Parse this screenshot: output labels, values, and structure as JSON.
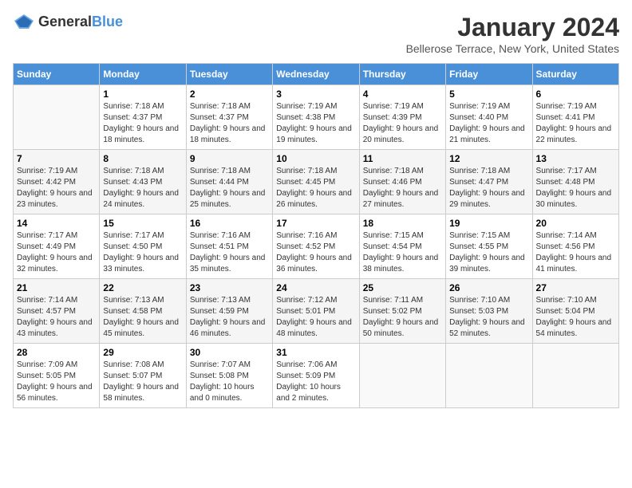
{
  "app": {
    "name_general": "General",
    "name_blue": "Blue"
  },
  "header": {
    "month": "January 2024",
    "location": "Bellerose Terrace, New York, United States"
  },
  "weekdays": [
    "Sunday",
    "Monday",
    "Tuesday",
    "Wednesday",
    "Thursday",
    "Friday",
    "Saturday"
  ],
  "weeks": [
    [
      {
        "day": "",
        "sunrise": "",
        "sunset": "",
        "daylight": ""
      },
      {
        "day": "1",
        "sunrise": "Sunrise: 7:18 AM",
        "sunset": "Sunset: 4:37 PM",
        "daylight": "Daylight: 9 hours and 18 minutes."
      },
      {
        "day": "2",
        "sunrise": "Sunrise: 7:18 AM",
        "sunset": "Sunset: 4:37 PM",
        "daylight": "Daylight: 9 hours and 18 minutes."
      },
      {
        "day": "3",
        "sunrise": "Sunrise: 7:19 AM",
        "sunset": "Sunset: 4:38 PM",
        "daylight": "Daylight: 9 hours and 19 minutes."
      },
      {
        "day": "4",
        "sunrise": "Sunrise: 7:19 AM",
        "sunset": "Sunset: 4:39 PM",
        "daylight": "Daylight: 9 hours and 20 minutes."
      },
      {
        "day": "5",
        "sunrise": "Sunrise: 7:19 AM",
        "sunset": "Sunset: 4:40 PM",
        "daylight": "Daylight: 9 hours and 21 minutes."
      },
      {
        "day": "6",
        "sunrise": "Sunrise: 7:19 AM",
        "sunset": "Sunset: 4:41 PM",
        "daylight": "Daylight: 9 hours and 22 minutes."
      }
    ],
    [
      {
        "day": "7",
        "sunrise": "Sunrise: 7:19 AM",
        "sunset": "Sunset: 4:42 PM",
        "daylight": "Daylight: 9 hours and 23 minutes."
      },
      {
        "day": "8",
        "sunrise": "Sunrise: 7:18 AM",
        "sunset": "Sunset: 4:43 PM",
        "daylight": "Daylight: 9 hours and 24 minutes."
      },
      {
        "day": "9",
        "sunrise": "Sunrise: 7:18 AM",
        "sunset": "Sunset: 4:44 PM",
        "daylight": "Daylight: 9 hours and 25 minutes."
      },
      {
        "day": "10",
        "sunrise": "Sunrise: 7:18 AM",
        "sunset": "Sunset: 4:45 PM",
        "daylight": "Daylight: 9 hours and 26 minutes."
      },
      {
        "day": "11",
        "sunrise": "Sunrise: 7:18 AM",
        "sunset": "Sunset: 4:46 PM",
        "daylight": "Daylight: 9 hours and 27 minutes."
      },
      {
        "day": "12",
        "sunrise": "Sunrise: 7:18 AM",
        "sunset": "Sunset: 4:47 PM",
        "daylight": "Daylight: 9 hours and 29 minutes."
      },
      {
        "day": "13",
        "sunrise": "Sunrise: 7:17 AM",
        "sunset": "Sunset: 4:48 PM",
        "daylight": "Daylight: 9 hours and 30 minutes."
      }
    ],
    [
      {
        "day": "14",
        "sunrise": "Sunrise: 7:17 AM",
        "sunset": "Sunset: 4:49 PM",
        "daylight": "Daylight: 9 hours and 32 minutes."
      },
      {
        "day": "15",
        "sunrise": "Sunrise: 7:17 AM",
        "sunset": "Sunset: 4:50 PM",
        "daylight": "Daylight: 9 hours and 33 minutes."
      },
      {
        "day": "16",
        "sunrise": "Sunrise: 7:16 AM",
        "sunset": "Sunset: 4:51 PM",
        "daylight": "Daylight: 9 hours and 35 minutes."
      },
      {
        "day": "17",
        "sunrise": "Sunrise: 7:16 AM",
        "sunset": "Sunset: 4:52 PM",
        "daylight": "Daylight: 9 hours and 36 minutes."
      },
      {
        "day": "18",
        "sunrise": "Sunrise: 7:15 AM",
        "sunset": "Sunset: 4:54 PM",
        "daylight": "Daylight: 9 hours and 38 minutes."
      },
      {
        "day": "19",
        "sunrise": "Sunrise: 7:15 AM",
        "sunset": "Sunset: 4:55 PM",
        "daylight": "Daylight: 9 hours and 39 minutes."
      },
      {
        "day": "20",
        "sunrise": "Sunrise: 7:14 AM",
        "sunset": "Sunset: 4:56 PM",
        "daylight": "Daylight: 9 hours and 41 minutes."
      }
    ],
    [
      {
        "day": "21",
        "sunrise": "Sunrise: 7:14 AM",
        "sunset": "Sunset: 4:57 PM",
        "daylight": "Daylight: 9 hours and 43 minutes."
      },
      {
        "day": "22",
        "sunrise": "Sunrise: 7:13 AM",
        "sunset": "Sunset: 4:58 PM",
        "daylight": "Daylight: 9 hours and 45 minutes."
      },
      {
        "day": "23",
        "sunrise": "Sunrise: 7:13 AM",
        "sunset": "Sunset: 4:59 PM",
        "daylight": "Daylight: 9 hours and 46 minutes."
      },
      {
        "day": "24",
        "sunrise": "Sunrise: 7:12 AM",
        "sunset": "Sunset: 5:01 PM",
        "daylight": "Daylight: 9 hours and 48 minutes."
      },
      {
        "day": "25",
        "sunrise": "Sunrise: 7:11 AM",
        "sunset": "Sunset: 5:02 PM",
        "daylight": "Daylight: 9 hours and 50 minutes."
      },
      {
        "day": "26",
        "sunrise": "Sunrise: 7:10 AM",
        "sunset": "Sunset: 5:03 PM",
        "daylight": "Daylight: 9 hours and 52 minutes."
      },
      {
        "day": "27",
        "sunrise": "Sunrise: 7:10 AM",
        "sunset": "Sunset: 5:04 PM",
        "daylight": "Daylight: 9 hours and 54 minutes."
      }
    ],
    [
      {
        "day": "28",
        "sunrise": "Sunrise: 7:09 AM",
        "sunset": "Sunset: 5:05 PM",
        "daylight": "Daylight: 9 hours and 56 minutes."
      },
      {
        "day": "29",
        "sunrise": "Sunrise: 7:08 AM",
        "sunset": "Sunset: 5:07 PM",
        "daylight": "Daylight: 9 hours and 58 minutes."
      },
      {
        "day": "30",
        "sunrise": "Sunrise: 7:07 AM",
        "sunset": "Sunset: 5:08 PM",
        "daylight": "Daylight: 10 hours and 0 minutes."
      },
      {
        "day": "31",
        "sunrise": "Sunrise: 7:06 AM",
        "sunset": "Sunset: 5:09 PM",
        "daylight": "Daylight: 10 hours and 2 minutes."
      },
      {
        "day": "",
        "sunrise": "",
        "sunset": "",
        "daylight": ""
      },
      {
        "day": "",
        "sunrise": "",
        "sunset": "",
        "daylight": ""
      },
      {
        "day": "",
        "sunrise": "",
        "sunset": "",
        "daylight": ""
      }
    ]
  ]
}
